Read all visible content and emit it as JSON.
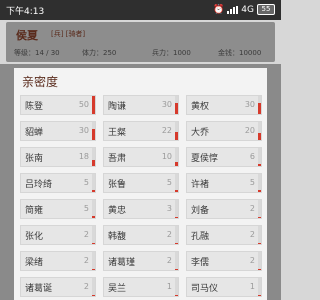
{
  "status": {
    "time": "下午4:13",
    "network": "4G",
    "battery": "55"
  },
  "background": {
    "name": "侯夏",
    "tags": "[兵] [骑者]",
    "stats": [
      "等级：14 / 30",
      "体力：250",
      "兵力：1000",
      "金钱：10000"
    ]
  },
  "dialog": {
    "title": "亲密度",
    "items": [
      {
        "name": "陈登",
        "value": 50,
        "level": 1.0
      },
      {
        "name": "陶谦",
        "value": 30,
        "level": 0.6
      },
      {
        "name": "黄权",
        "value": 30,
        "level": 0.6
      },
      {
        "name": "貂蝉",
        "value": 30,
        "level": 0.6
      },
      {
        "name": "王粲",
        "value": 22,
        "level": 0.44
      },
      {
        "name": "大乔",
        "value": 20,
        "level": 0.4
      },
      {
        "name": "张南",
        "value": 18,
        "level": 0.36
      },
      {
        "name": "吾肃",
        "value": 10,
        "level": 0.2
      },
      {
        "name": "夏侯惇",
        "value": 6,
        "level": 0.12
      },
      {
        "name": "吕玲绮",
        "value": 5,
        "level": 0.1
      },
      {
        "name": "张鲁",
        "value": 5,
        "level": 0.1
      },
      {
        "name": "许褚",
        "value": 5,
        "level": 0.1
      },
      {
        "name": "简雍",
        "value": 5,
        "level": 0.1
      },
      {
        "name": "黄忠",
        "value": 3,
        "level": 0.06
      },
      {
        "name": "刘备",
        "value": 2,
        "level": 0.04
      },
      {
        "name": "张化",
        "value": 2,
        "level": 0.04
      },
      {
        "name": "韩馥",
        "value": 2,
        "level": 0.04
      },
      {
        "name": "孔融",
        "value": 2,
        "level": 0.04
      },
      {
        "name": "梁绪",
        "value": 2,
        "level": 0.04
      },
      {
        "name": "诸葛瑾",
        "value": 2,
        "level": 0.04
      },
      {
        "name": "李儒",
        "value": 2,
        "level": 0.04
      },
      {
        "name": "诸葛诞",
        "value": 2,
        "level": 0.04
      },
      {
        "name": "吴兰",
        "value": 1,
        "level": 0.02
      },
      {
        "name": "司马仪",
        "value": 1,
        "level": 0.02
      }
    ]
  },
  "colors": {
    "accent": "#d63a2c",
    "title": "#5a2b1c"
  }
}
